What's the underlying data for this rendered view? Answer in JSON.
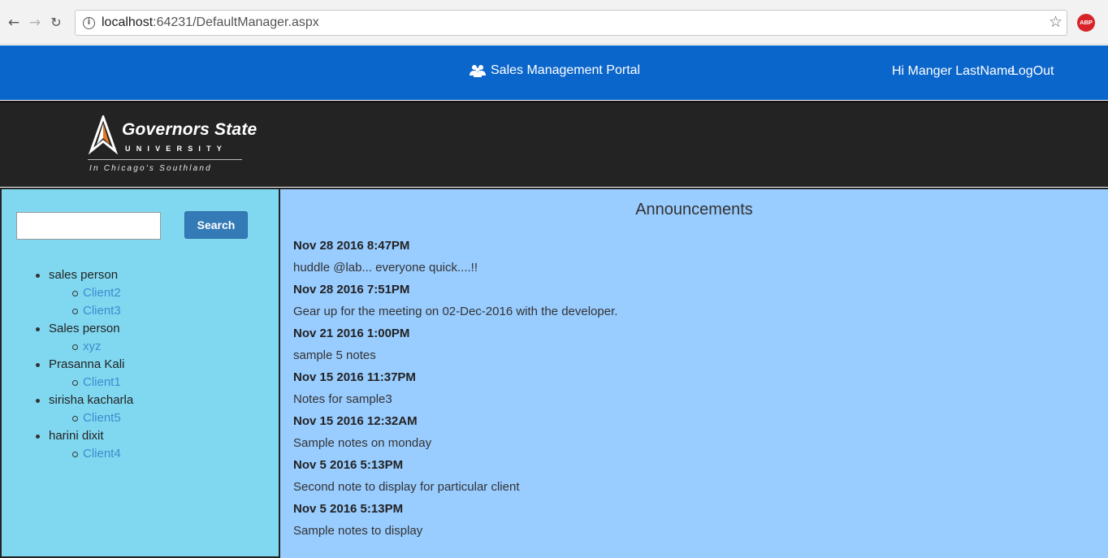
{
  "browser": {
    "url_host": "localhost",
    "url_rest": ":64231/DefaultManager.aspx",
    "extension_label": "ABP"
  },
  "topnav": {
    "title": "Sales Management Portal",
    "greeting": "Hi Manger LastName",
    "logout_label": "LogOut"
  },
  "logo": {
    "name": "Governors State",
    "sub": "UNIVERSITY",
    "tagline": "In Chicago's Southland"
  },
  "sidebar": {
    "search_placeholder": "",
    "search_label": "Search",
    "people": [
      {
        "name": "sales person",
        "clients": [
          "Client2",
          "Client3"
        ]
      },
      {
        "name": "Sales person",
        "clients": [
          "xyz"
        ]
      },
      {
        "name": "Prasanna Kali",
        "clients": [
          "Client1"
        ]
      },
      {
        "name": "sirisha kacharla",
        "clients": [
          "Client5"
        ]
      },
      {
        "name": "harini dixit",
        "clients": [
          "Client4"
        ]
      }
    ]
  },
  "announcements": {
    "heading": "Announcements",
    "items": [
      {
        "date": "Nov 28 2016 8:47PM",
        "text": "huddle @lab... everyone quick....!!"
      },
      {
        "date": "Nov 28 2016 7:51PM",
        "text": "Gear up for the meeting on 02-Dec-2016 with the developer."
      },
      {
        "date": "Nov 21 2016 1:00PM",
        "text": "sample 5 notes"
      },
      {
        "date": "Nov 15 2016 11:37PM",
        "text": "Notes for sample3"
      },
      {
        "date": "Nov 15 2016 12:32AM",
        "text": "Sample notes on monday"
      },
      {
        "date": "Nov 5 2016 5:13PM",
        "text": "Second note to display for particular client"
      },
      {
        "date": "Nov 5 2016 5:13PM",
        "text": "Sample notes to display"
      }
    ]
  },
  "colors": {
    "topnav": "#0b66cc",
    "logo_band": "#232323",
    "sidebar": "#80d8f0",
    "main": "#99ccff",
    "link": "#3a8ccf",
    "button": "#337ab7"
  }
}
